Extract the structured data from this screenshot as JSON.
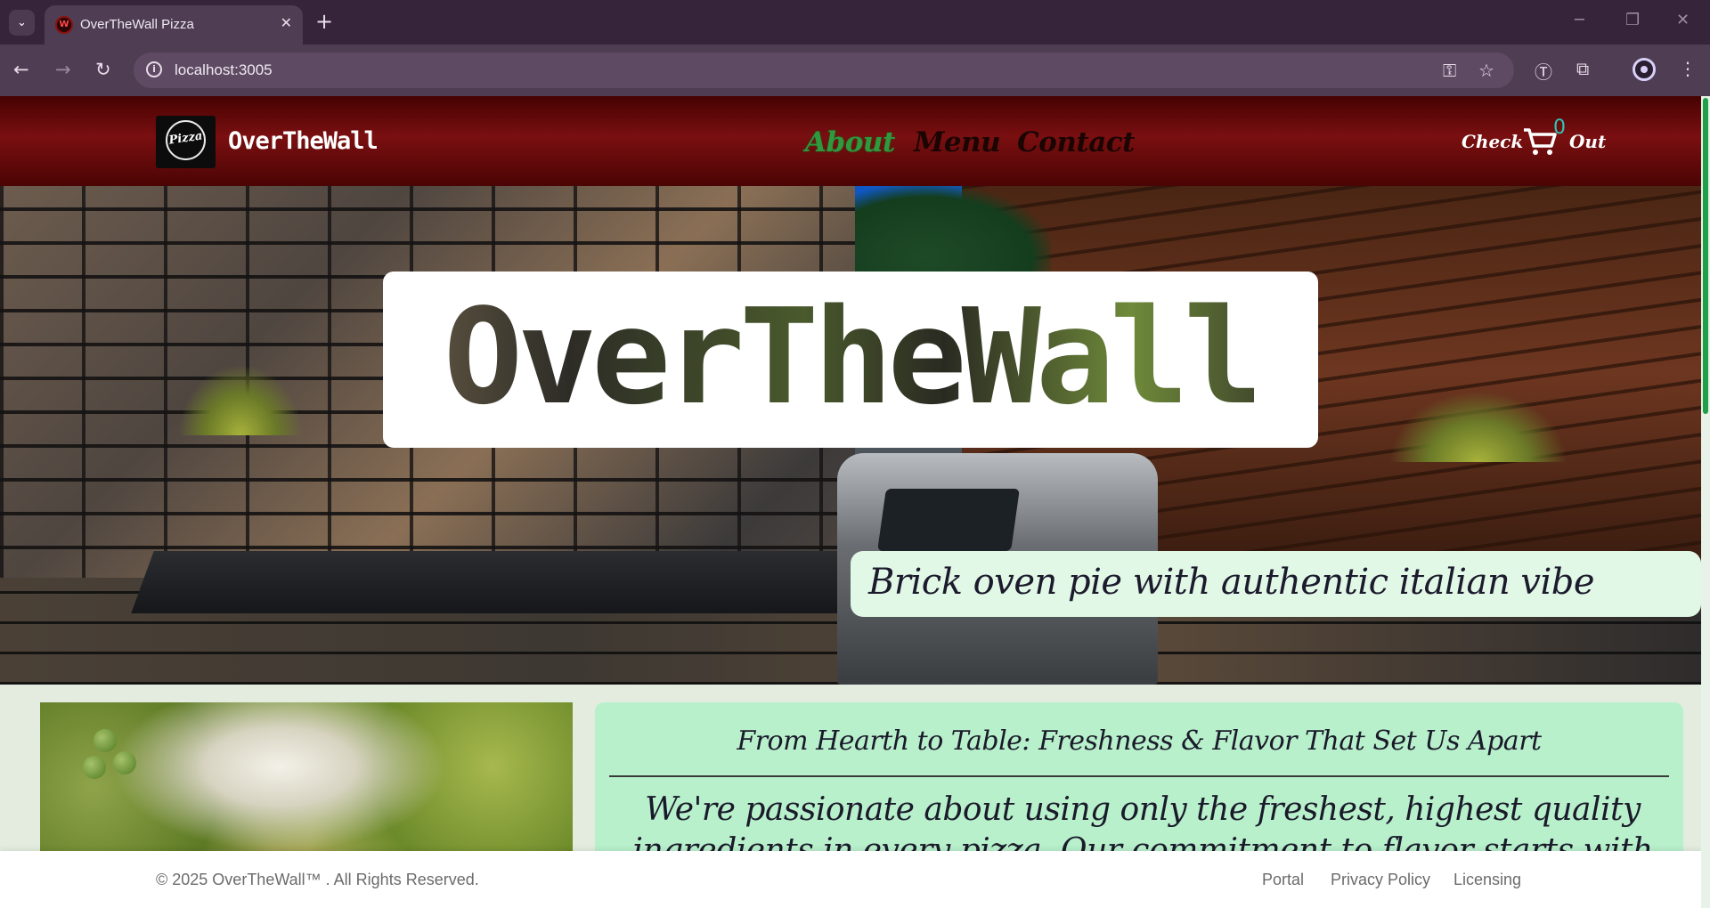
{
  "browser": {
    "tab_title": "OverTheWall Pizza",
    "tab_favicon_letter": "W",
    "url": "localhost:3005"
  },
  "header": {
    "logo_text": "Pizza",
    "brand": "OverTheWall",
    "nav": [
      {
        "label": "About",
        "active": true
      },
      {
        "label": "Menu",
        "active": false
      },
      {
        "label": "Contact",
        "active": false
      }
    ],
    "checkout_left": "Check",
    "checkout_right": "Out",
    "cart_count": "0"
  },
  "hero": {
    "title": "OverTheWall",
    "tagline": "Brick oven pie with authentic italian vibe"
  },
  "about": {
    "heading": "From Hearth to Table: Freshness & Flavor That Set Us Apart",
    "body": "We're passionate about using only the freshest, highest quality ingredients in every pizza. Our commitment to flavor starts with locally sourced produce and time–"
  },
  "footer": {
    "copyright": "© 2025 OverTheWall™ . All Rights Reserved.",
    "links": [
      "Portal",
      "Privacy Policy",
      "Licensing"
    ]
  },
  "colors": {
    "header_red": "#7a0f10",
    "nav_active": "#2e9a3d",
    "about_card": "#b8f0cc",
    "tagline_bg": "#e2f8e6"
  }
}
